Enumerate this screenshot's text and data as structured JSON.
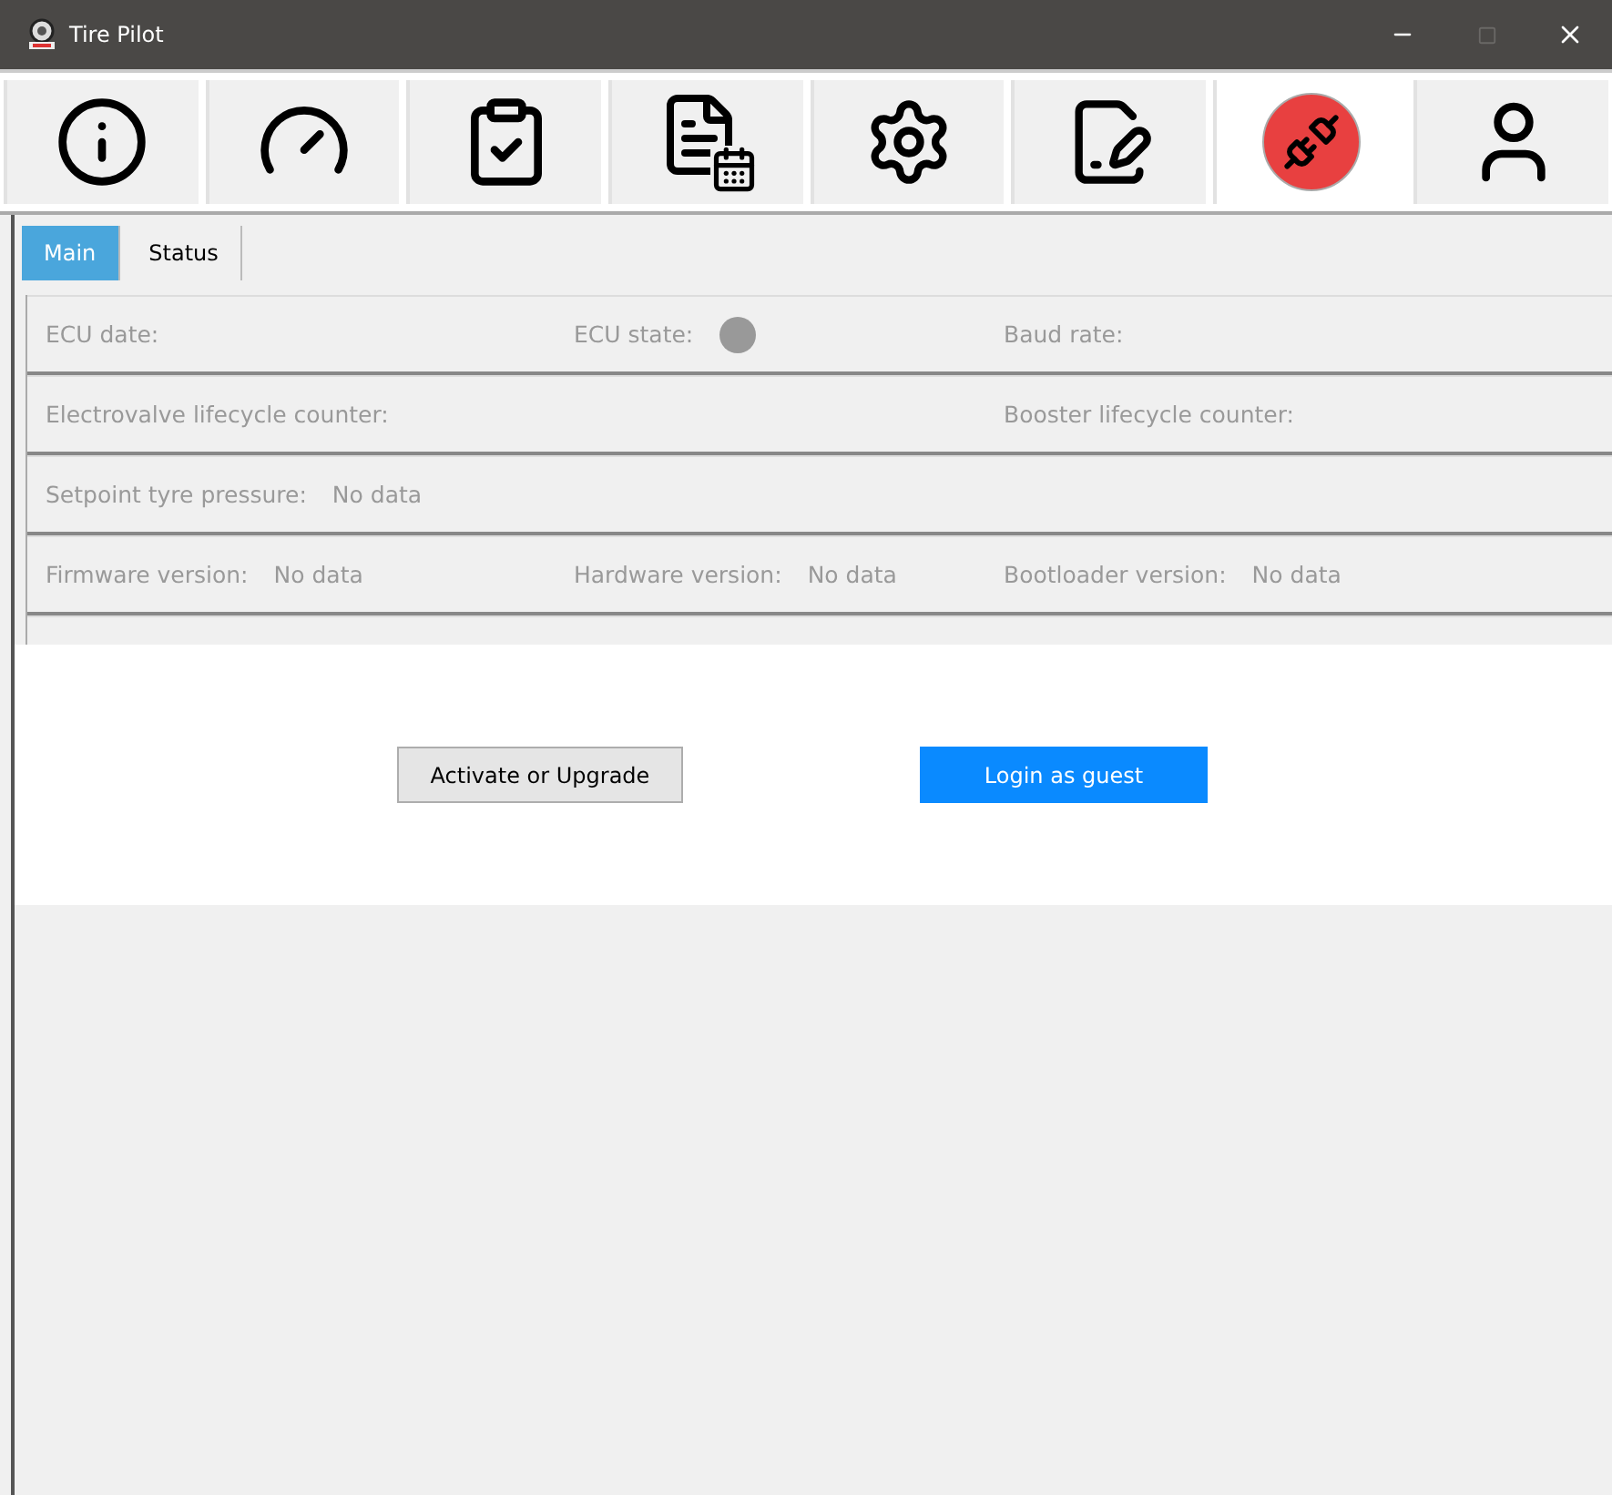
{
  "window": {
    "title": "Tire Pilot"
  },
  "toolbar": [
    {
      "kind": "info",
      "selected": false
    },
    {
      "kind": "gauge",
      "selected": false
    },
    {
      "kind": "checklist",
      "selected": false
    },
    {
      "kind": "schedule",
      "selected": false
    },
    {
      "kind": "settings",
      "selected": false
    },
    {
      "kind": "signature",
      "selected": false
    },
    {
      "kind": "connection",
      "selected": true
    },
    {
      "kind": "user",
      "selected": false
    }
  ],
  "tabs": [
    {
      "label": "Main",
      "selected": true
    },
    {
      "label": "Status",
      "selected": false
    }
  ],
  "rows": [
    [
      {
        "label": "ECU date:"
      },
      {
        "label": "ECU state:",
        "kind": "dot"
      },
      {
        "label": "Baud rate:"
      }
    ],
    [
      {
        "label": "Electrovalve lifecycle counter:"
      },
      null,
      {
        "label": "Booster lifecycle counter:"
      }
    ],
    [
      {
        "label": "Setpoint tyre pressure:",
        "value": "No data"
      },
      null,
      null
    ],
    [
      {
        "label": "Firmware version:",
        "value": "No data"
      },
      {
        "label": "Hardware version:",
        "value": "No data"
      },
      {
        "label": "Bootloader version:",
        "value": "No data"
      }
    ]
  ],
  "buttons": [
    {
      "label": "Activate or Upgrade",
      "kind": "secondary"
    },
    {
      "label": "Login as guest",
      "kind": "primary"
    }
  ]
}
